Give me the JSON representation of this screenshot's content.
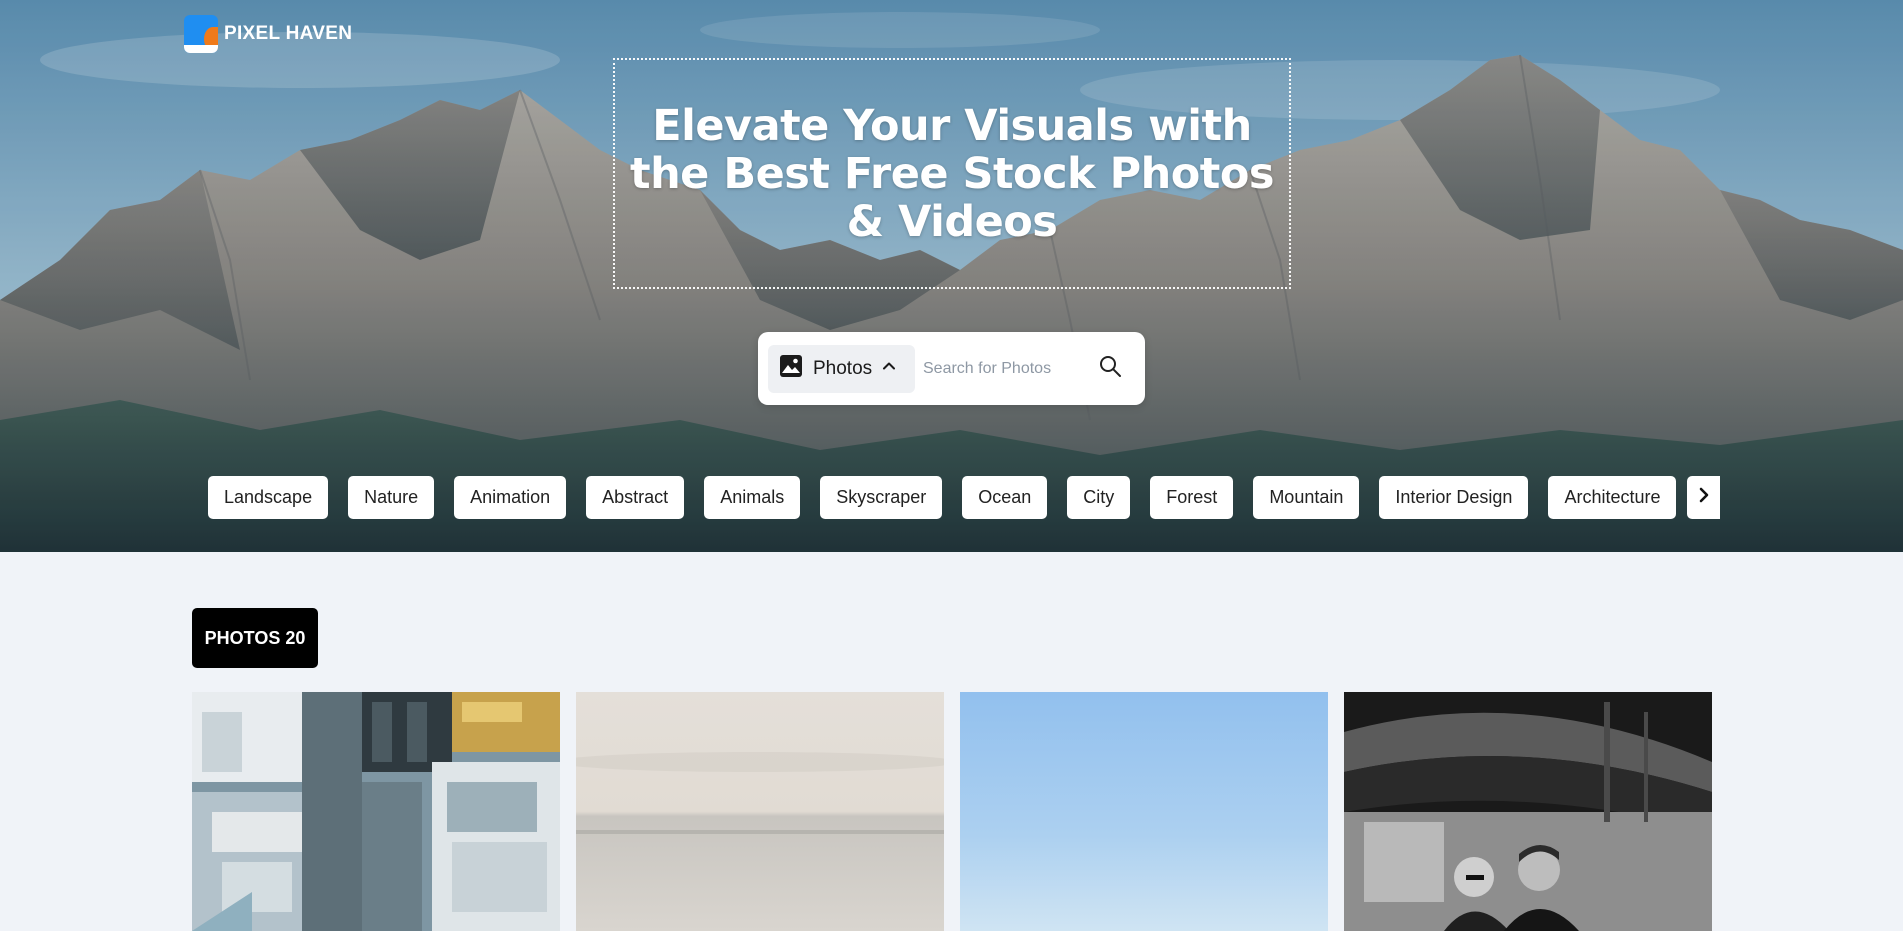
{
  "brand": {
    "name": "PIXEL HAVEN",
    "accent": "#1f8ef1",
    "accent2": "#ef7a1a"
  },
  "hero": {
    "headline": "Elevate Your Visuals with the Best Free Stock Photos & Videos",
    "search": {
      "type_label": "Photos",
      "placeholder": "Search for Photos"
    },
    "categories": [
      "Landscape",
      "Nature",
      "Animation",
      "Abstract",
      "Animals",
      "Skyscraper",
      "Ocean",
      "City",
      "Forest",
      "Mountain",
      "Interior Design",
      "Architecture"
    ]
  },
  "gallery": {
    "count_label": "PHOTOS 20",
    "photos": [
      {
        "subject": "aerial city buildings"
      },
      {
        "subject": "calm sea horizon"
      },
      {
        "subject": "blue sky"
      },
      {
        "subject": "black and white couple"
      }
    ]
  },
  "icons": {
    "type_icon": "image-icon",
    "chevron": "chevron-up-icon",
    "search": "search-icon",
    "next": "chevron-right-icon"
  }
}
